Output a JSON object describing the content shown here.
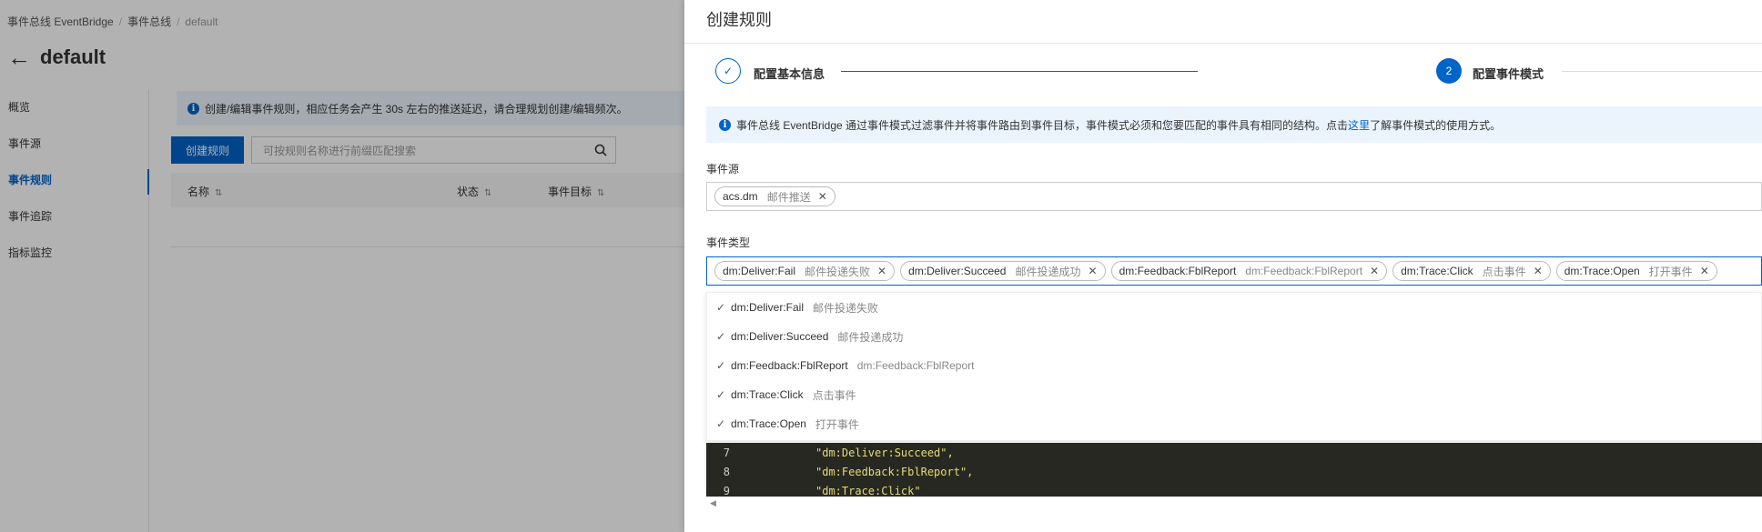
{
  "breadcrumb": {
    "item1": "事件总线 EventBridge",
    "item2": "事件总线",
    "item3": "default"
  },
  "page": {
    "title": "default",
    "back_icon": "←"
  },
  "sidebar": {
    "items": [
      {
        "label": "概览"
      },
      {
        "label": "事件源"
      },
      {
        "label": "事件规则"
      },
      {
        "label": "事件追踪"
      },
      {
        "label": "指标监控"
      }
    ]
  },
  "main": {
    "notice": "创建/编辑事件规则，相应任务会产生 30s 左右的推送延迟，请合理规划创建/编辑频次。",
    "create_button": "创建规则",
    "search_placeholder": "可按规则名称进行前缀匹配搜索",
    "table_headers": [
      "名称",
      "状态",
      "事件目标"
    ]
  },
  "drawer": {
    "title": "创建规则",
    "steps": [
      {
        "label": "配置基本信息",
        "state": "done",
        "marker": "✓"
      },
      {
        "label": "配置事件模式",
        "state": "current",
        "marker": "2"
      }
    ],
    "notice": {
      "prefix": "事件总线 EventBridge 通过事件模式过滤事件并将事件路由到事件目标，事件模式必须和您要匹配的事件具有相同的结构。点击",
      "link": "这里",
      "suffix": "了解事件模式的使用方式。"
    },
    "event_source": {
      "label": "事件源",
      "tags": [
        {
          "code": "acs.dm",
          "desc": "邮件推送"
        }
      ]
    },
    "event_type": {
      "label": "事件类型",
      "tags": [
        {
          "code": "dm:Deliver:Fail",
          "desc": "邮件投递失败"
        },
        {
          "code": "dm:Deliver:Succeed",
          "desc": "邮件投递成功"
        },
        {
          "code": "dm:Feedback:FblReport",
          "desc": "dm:Feedback:FblReport"
        },
        {
          "code": "dm:Trace:Click",
          "desc": "点击事件"
        },
        {
          "code": "dm:Trace:Open",
          "desc": "打开事件"
        }
      ],
      "options": [
        {
          "code": "dm:Deliver:Fail",
          "desc": "邮件投递失败"
        },
        {
          "code": "dm:Deliver:Succeed",
          "desc": "邮件投递成功"
        },
        {
          "code": "dm:Feedback:FblReport",
          "desc": "dm:Feedback:FblReport"
        },
        {
          "code": "dm:Trace:Click",
          "desc": "点击事件"
        },
        {
          "code": "dm:Trace:Open",
          "desc": "打开事件"
        }
      ]
    },
    "code": {
      "lines": [
        {
          "num": "7",
          "text": "\"dm:Deliver:Succeed\","
        },
        {
          "num": "8",
          "text": "\"dm:Feedback:FblReport\","
        },
        {
          "num": "9",
          "text": "\"dm:Trace:Click\""
        }
      ]
    },
    "colors": {
      "primary": "#0064c8",
      "notice_bg": "#ebf4fd",
      "editor_bg": "#272822",
      "string": "#e6db74"
    }
  }
}
